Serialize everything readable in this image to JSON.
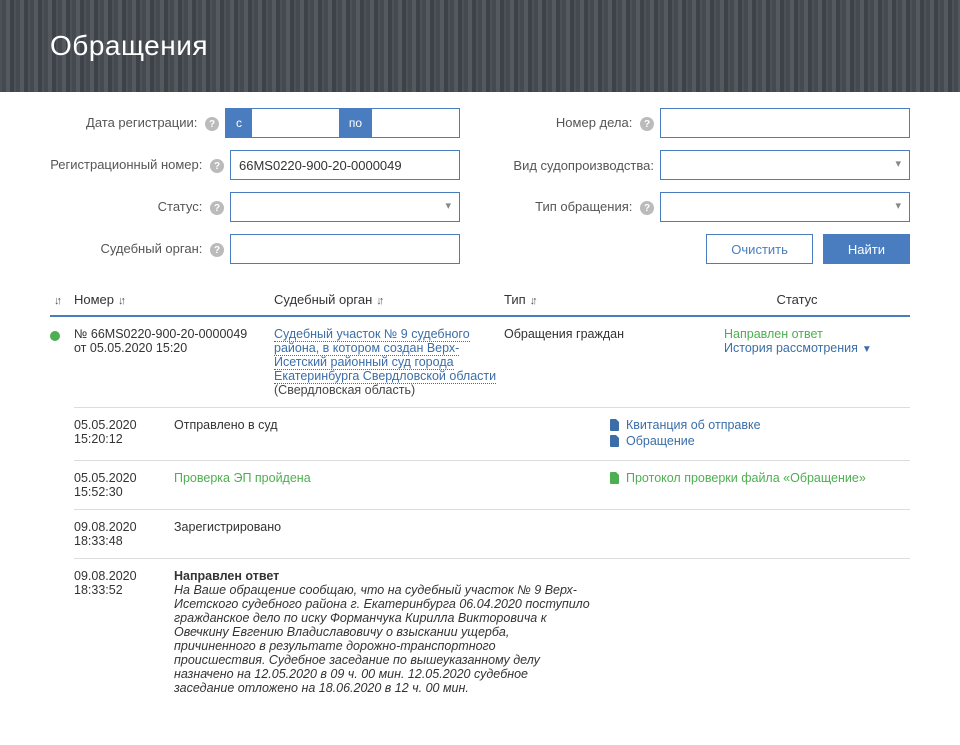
{
  "page": {
    "title": "Обращения"
  },
  "filters": {
    "labels": {
      "date_reg": "Дата регистрации:",
      "reg_number": "Регистрационный номер:",
      "status": "Статус:",
      "court": "Судебный орган:",
      "case_number": "Номер дела:",
      "proceeding_type": "Вид судопроизводства:",
      "appeal_type": "Тип обращения:"
    },
    "date_range": {
      "from_tag": "с",
      "to_tag": "по",
      "from": "",
      "to": ""
    },
    "reg_number": "66MS0220-900-20-0000049",
    "status": "",
    "court": "",
    "case_number": "",
    "proceeding_type": "",
    "appeal_type": "",
    "buttons": {
      "clear": "Очистить",
      "search": "Найти"
    }
  },
  "table": {
    "headers": {
      "number": "Номер",
      "court": "Судебный орган",
      "type": "Тип",
      "status": "Статус"
    },
    "row": {
      "number_line1": "№ 66MS0220-900-20-0000049",
      "number_line2": "от 05.05.2020 15:20",
      "court_link": "Судебный участок № 9 судебного района, в котором создан Верх-Исетский районный суд города Екатеринбурга Свердловской области",
      "court_region": " (Свердловская область)",
      "type": "Обращения граждан",
      "status": "Направлен ответ",
      "history_link": "История рассмотрения"
    },
    "sub": [
      {
        "date": "05.05.2020",
        "time": "15:20:12",
        "event": "Отправлено в суд",
        "event_style": "plain",
        "links": [
          {
            "label": "Квитанция об отправке",
            "color": "blue"
          },
          {
            "label": "Обращение",
            "color": "blue"
          }
        ]
      },
      {
        "date": "05.05.2020",
        "time": "15:52:30",
        "event": "Проверка ЭП пройдена",
        "event_style": "green",
        "links": [
          {
            "label": "Протокол проверки файла «Обращение»",
            "color": "green"
          }
        ]
      },
      {
        "date": "09.08.2020",
        "time": "18:33:48",
        "event": "Зарегистрировано",
        "event_style": "plain",
        "links": []
      },
      {
        "date": "09.08.2020",
        "time": "18:33:52",
        "event_title": "Направлен ответ",
        "event_body": "На Ваше обращение сообщаю, что на судебный участок № 9 Верх-Исетского судебного района г. Екатеринбурга 06.04.2020 поступило гражданское дело по иску Форманчука Кирилла Викторовича к Овечкину Евгению Владиславовичу о взыскании ущерба, причиненного в результате дорожно-транспортного происшествия. Судебное заседание по вышеуказанному делу назначено на 12.05.2020 в 09 ч. 00 мин. 12.05.2020 судебное заседание отложено на 18.06.2020 в 12 ч. 00 мин.",
        "event_style": "response",
        "links": []
      }
    ]
  }
}
